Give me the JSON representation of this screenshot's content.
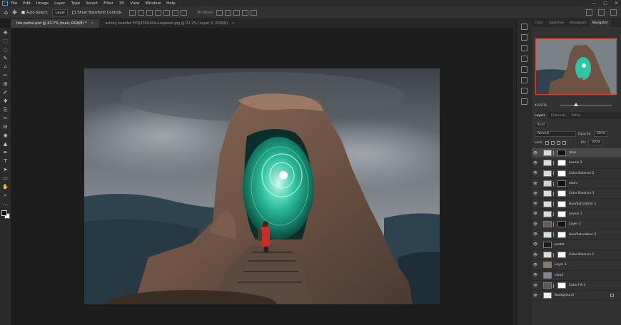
{
  "menubar": {
    "app_badge": "Ps",
    "items": [
      "File",
      "Edit",
      "Image",
      "Layer",
      "Type",
      "Select",
      "Filter",
      "3D",
      "View",
      "Window",
      "Help"
    ],
    "window_controls": [
      "—",
      "□",
      "✕"
    ]
  },
  "options": {
    "auto_select_label": "Auto-Select:",
    "target_value": "Layer",
    "transform_label": "Show Transform Controls",
    "mode_3d_label": "3D Mode:"
  },
  "tabs": [
    {
      "label": "the portal.psd @ 43.7% (man, RGB/8) *",
      "close": "×"
    },
    {
      "label": "ashley knedler FVSJ5TA5444-unsplash.jpg @ 22.2% (Layer 0, RGB/8)",
      "close": "×"
    }
  ],
  "tools": [
    "✥",
    "⬚",
    "◌",
    "✎",
    "⌗",
    "✂",
    "⊞",
    "✐",
    "✚",
    "⎘",
    "✏",
    "⊟",
    "◉",
    "▲",
    "✒",
    "T",
    "➤",
    "▭",
    "✋",
    "⌕",
    "…"
  ],
  "dock_icons": [
    "history-icon",
    "adjustments-icon",
    "brush-icon",
    "cube-icon",
    "swatch-icon",
    "info-icon"
  ],
  "panel": {
    "tabs": [
      "Color",
      "Swatches",
      "Histogram",
      "Navigator"
    ],
    "active_tab": "Navigator",
    "zoom_value": "43.67%",
    "zoom_fraction": 0.3,
    "layer_tabs": [
      "Layers",
      "Channels",
      "Paths"
    ],
    "active_layer_tab": "Layers",
    "filter_label": "Kind",
    "blend_mode": "Normal",
    "opacity_label": "Opacity:",
    "opacity_value": "100%",
    "lock_label": "Lock:",
    "fill_label": "Fill:",
    "fill_value": "100%"
  },
  "layers": [
    {
      "name": "man",
      "selected": true,
      "thumb": "#d9d9d9",
      "mask": "#111111",
      "adj": false
    },
    {
      "name": "Levels 2",
      "selected": false,
      "thumb": "#dddddd",
      "mask": "#ffffff",
      "adj": true
    },
    {
      "name": "Color Balance 2",
      "selected": false,
      "thumb": "#dddddd",
      "mask": "#ffffff",
      "adj": true
    },
    {
      "name": "stairs",
      "selected": false,
      "thumb": "#d0d0d0",
      "mask": "#111111",
      "adj": false
    },
    {
      "name": "Color Balance 3",
      "selected": false,
      "thumb": "#dddddd",
      "mask": "#ffffff",
      "adj": true
    },
    {
      "name": "Hue/Saturation 1",
      "selected": false,
      "thumb": "#dddddd",
      "mask": "#ffffff",
      "adj": true
    },
    {
      "name": "Levels 1",
      "selected": false,
      "thumb": "#dddddd",
      "mask": "#ffffff",
      "adj": true
    },
    {
      "name": "Layer 2",
      "selected": false,
      "thumb": "#6b5a4e",
      "mask": "#111111",
      "adj": false
    },
    {
      "name": "Hue/Saturation 3",
      "selected": false,
      "thumb": "#dddddd",
      "mask": "#ffffff",
      "adj": true
    },
    {
      "name": "portal",
      "selected": false,
      "thumb": "#1c1c1c",
      "mask": "",
      "adj": false
    },
    {
      "name": "Color Balance 1",
      "selected": false,
      "thumb": "#dddddd",
      "mask": "#ffffff",
      "adj": true
    },
    {
      "name": "Layer 1",
      "selected": false,
      "thumb": "#8a7a6a",
      "mask": "",
      "adj": false
    },
    {
      "name": "cloud",
      "selected": false,
      "thumb": "#7d8590",
      "mask": "",
      "adj": false
    },
    {
      "name": "Color Fill 1",
      "selected": false,
      "thumb": "#5a5a5a",
      "mask": "#ffffff",
      "adj": true
    },
    {
      "name": "Background",
      "selected": false,
      "thumb": "#eeeeee",
      "mask": "",
      "adj": false
    }
  ]
}
